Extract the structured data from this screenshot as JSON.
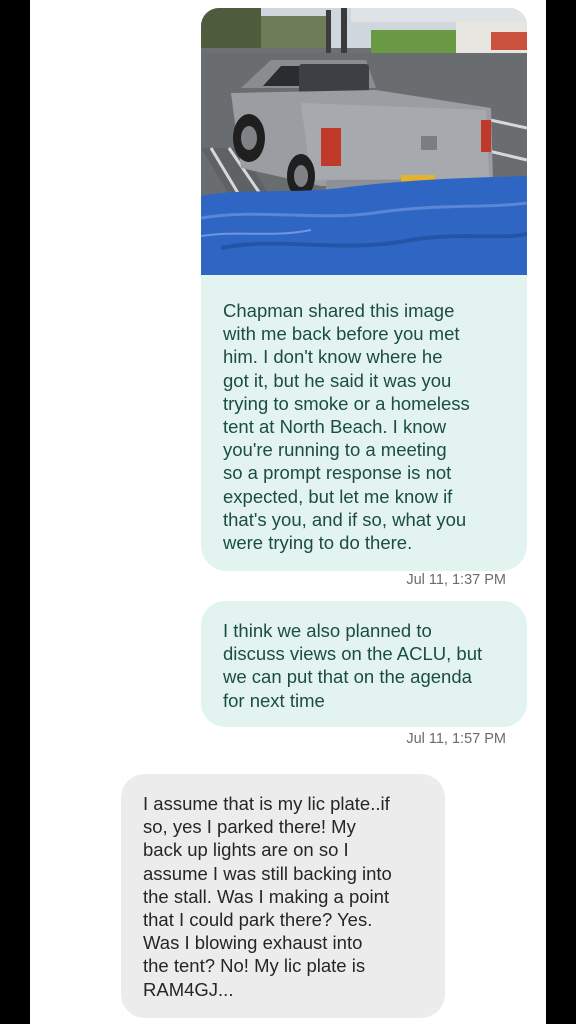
{
  "messages": [
    {
      "direction": "sent",
      "attachment": "truck-photo",
      "text": "Chapman shared this image\nwith me back before you met\nhim. I don't know where he\ngot it, but he said it was you\ntrying to smoke or a homeless\ntent at North Beach. I know\nyou're running to a meeting\nso a prompt response is not\nexpected, but let me know if\nthat's you, and if so, what you\nwere trying to do there.",
      "timestamp": "Jul 11, 1:37 PM"
    },
    {
      "direction": "sent",
      "text": "I think we also planned to\ndiscuss views on the ACLU, but\nwe can put that on the agenda\nfor next time",
      "timestamp": "Jul 11, 1:57 PM"
    },
    {
      "direction": "received",
      "text": "I assume that is my lic plate..if\nso, yes I parked there!   My\nback up lights are on so I\nassume I was still backing into\nthe stall.   Was I making a point\nthat I could park there?  Yes.\nWas I blowing exhaust into\nthe tent?  No!   My lic plate is\nRAM4GJ..."
    }
  ],
  "colors": {
    "sent_bubble": "#e2f3f0",
    "sent_text": "#1b4d45",
    "received_bubble": "#ececed",
    "received_text": "#262626",
    "timestamp": "#6b6b6b",
    "tarp_blue": "#2f66c4"
  }
}
